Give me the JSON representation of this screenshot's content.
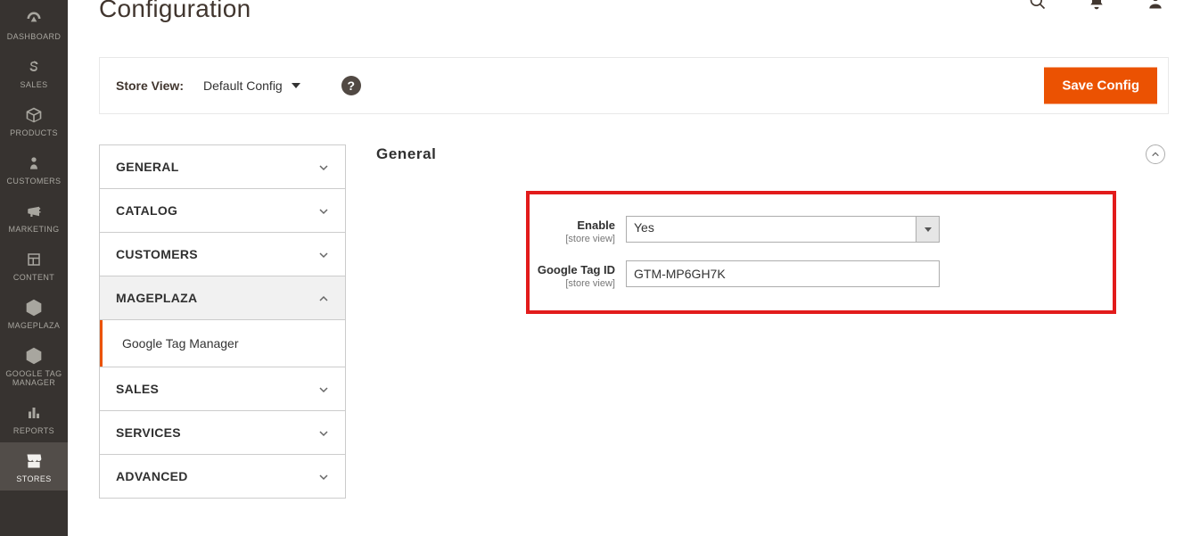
{
  "sidenav": [
    {
      "name": "dashboard",
      "label": "DASHBOARD"
    },
    {
      "name": "sales",
      "label": "SALES"
    },
    {
      "name": "products",
      "label": "PRODUCTS"
    },
    {
      "name": "customers",
      "label": "CUSTOMERS"
    },
    {
      "name": "marketing",
      "label": "MARKETING"
    },
    {
      "name": "content",
      "label": "CONTENT"
    },
    {
      "name": "mageplaza",
      "label": "MAGEPLAZA"
    },
    {
      "name": "gtm",
      "label": "GOOGLE TAG\nMANAGER"
    },
    {
      "name": "reports",
      "label": "REPORTS"
    },
    {
      "name": "stores",
      "label": "STORES"
    }
  ],
  "header": {
    "title": "Configuration",
    "store_view_label": "Store View:",
    "store_view_value": "Default Config",
    "save_label": "Save Config"
  },
  "accordion": {
    "items": [
      {
        "label": "GENERAL",
        "expanded": false
      },
      {
        "label": "CATALOG",
        "expanded": false
      },
      {
        "label": "CUSTOMERS",
        "expanded": false
      },
      {
        "label": "MAGEPLAZA",
        "expanded": true,
        "sub": [
          {
            "label": "Google Tag Manager",
            "active": true
          }
        ]
      },
      {
        "label": "SALES",
        "expanded": false
      },
      {
        "label": "SERVICES",
        "expanded": false
      },
      {
        "label": "ADVANCED",
        "expanded": false
      }
    ]
  },
  "section": {
    "title": "General",
    "fields": {
      "enable": {
        "label": "Enable",
        "scope": "[store view]",
        "value": "Yes"
      },
      "tag_id": {
        "label": "Google Tag ID",
        "scope": "[store view]",
        "value": "GTM-MP6GH7K"
      }
    }
  }
}
